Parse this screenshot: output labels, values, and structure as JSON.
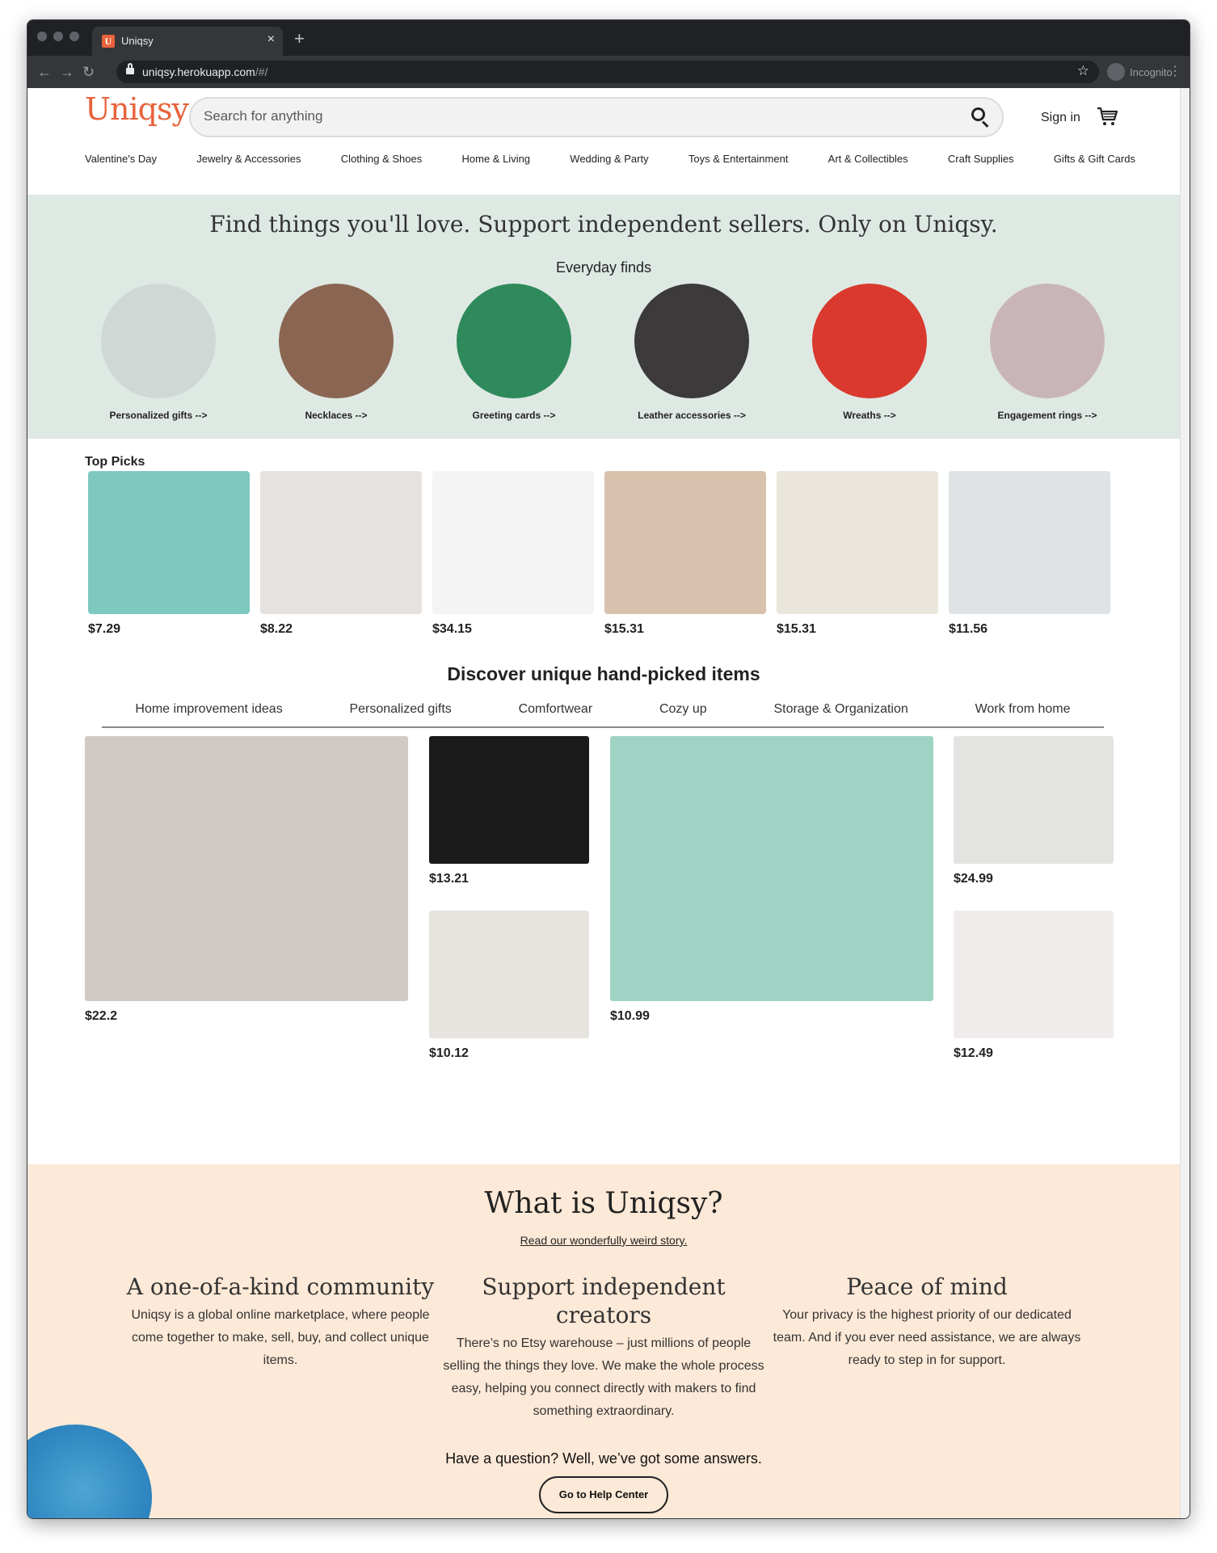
{
  "browser": {
    "tab_title": "Uniqsy",
    "tab_favicon": "U",
    "url_host": "uniqsy.herokuapp.com",
    "url_path": "/#/",
    "incognito_label": "Incognito"
  },
  "header": {
    "logo": "Uniqsy",
    "search_placeholder": "Search for anything",
    "signin": "Sign in"
  },
  "categories": [
    "Valentine's Day",
    "Jewelry & Accessories",
    "Clothing & Shoes",
    "Home & Living",
    "Wedding & Party",
    "Toys & Entertainment",
    "Art & Collectibles",
    "Craft Supplies",
    "Gifts & Gift Cards"
  ],
  "hero": {
    "title": "Find things you'll love. Support independent sellers. Only on Uniqsy.",
    "subtitle": "Everyday finds",
    "items": [
      {
        "label": "Personalized gifts -->",
        "color": "#cfd8d4"
      },
      {
        "label": "Necklaces -->",
        "color": "#8a6652"
      },
      {
        "label": "Greeting cards -->",
        "color": "#2e8a5a"
      },
      {
        "label": "Leather accessories -->",
        "color": "#3c3a3a"
      },
      {
        "label": "Wreaths -->",
        "color": "#d9392e"
      },
      {
        "label": "Engagement rings -->",
        "color": "#c9b5b8"
      }
    ]
  },
  "top_picks": {
    "title": "Top Picks",
    "items": [
      {
        "price": "$7.29",
        "color": "#7fc8c0"
      },
      {
        "price": "$8.22",
        "color": "#e6e2df"
      },
      {
        "price": "$34.15",
        "color": "#f4f4f4"
      },
      {
        "price": "$15.31",
        "color": "#d9c2ad"
      },
      {
        "price": "$15.31",
        "color": "#ebe6dc"
      },
      {
        "price": "$11.56",
        "color": "#dfe3e6"
      }
    ]
  },
  "discover": {
    "title": "Discover unique hand-picked items",
    "tabs": [
      "Home improvement ideas",
      "Personalized gifts",
      "Comfortwear",
      "Cozy up",
      "Storage & Organization",
      "Work from home"
    ],
    "items": [
      {
        "price": "$22.2",
        "color": "#cfcac3"
      },
      {
        "price": "$13.21",
        "color": "#1a1a1a"
      },
      {
        "price": "$10.12",
        "color": "#e7e4df"
      },
      {
        "price": "$10.99",
        "color": "#9fd4c4"
      },
      {
        "price": "$24.99",
        "color": "#e3e3e1"
      },
      {
        "price": "$12.49",
        "color": "#efeceb"
      }
    ]
  },
  "about": {
    "title": "What is Uniqsy?",
    "link": "Read our wonderfully weird story.",
    "columns": [
      {
        "title": "A one-of-a-kind community",
        "text": "Uniqsy is a global online marketplace, where people come together to make, sell, buy, and collect unique items."
      },
      {
        "title": "Support independent creators",
        "text": "There’s no Etsy warehouse – just millions of people selling the things they love. We make the whole process easy, helping you connect directly with makers to find something extraordinary."
      },
      {
        "title": "Peace of mind",
        "text": "Your privacy is the highest priority of our dedicated team. And if you ever need assistance, we are always ready to step in for support."
      }
    ],
    "question": "Have a question? Well, we’ve got some answers.",
    "help_button": "Go to Help Center"
  }
}
